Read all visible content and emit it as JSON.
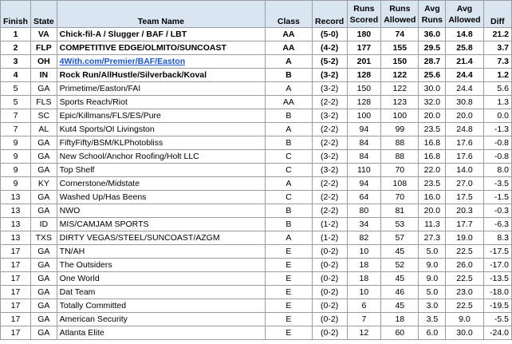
{
  "headers": {
    "finish": "Finish",
    "state": "State",
    "team_name": "Team Name",
    "class": "Class",
    "record": "Record",
    "runs_scored": [
      "Runs",
      "Scored"
    ],
    "runs_allowed": [
      "Runs",
      "Allowed"
    ],
    "avg_runs": [
      "Avg",
      "Runs"
    ],
    "avg_allowed": [
      "Avg",
      "Allowed"
    ],
    "diff": "Diff"
  },
  "rows": [
    {
      "finish": "1",
      "state": "VA",
      "team": "Chick-fil-A / Slugger / BAF / LBT",
      "class": "AA",
      "record": "(5-0)",
      "scored": "180",
      "allowed": "74",
      "avg_runs": "36.0",
      "avg_allowed": "14.8",
      "diff": "21.2",
      "bold": true,
      "link": false
    },
    {
      "finish": "2",
      "state": "FLP",
      "team": "COMPETITIVE EDGE/OLMITO/SUNCOAST",
      "class": "AA",
      "record": "(4-2)",
      "scored": "177",
      "allowed": "155",
      "avg_runs": "29.5",
      "avg_allowed": "25.8",
      "diff": "3.7",
      "bold": true,
      "link": false
    },
    {
      "finish": "3",
      "state": "OH",
      "team": "4With.com/Premier/BAF/Easton",
      "class": "A",
      "record": "(5-2)",
      "scored": "201",
      "allowed": "150",
      "avg_runs": "28.7",
      "avg_allowed": "21.4",
      "diff": "7.3",
      "bold": true,
      "link": true
    },
    {
      "finish": "4",
      "state": "IN",
      "team": "Rock Run/AllHustle/Silverback/Koval",
      "class": "B",
      "record": "(3-2)",
      "scored": "128",
      "allowed": "122",
      "avg_runs": "25.6",
      "avg_allowed": "24.4",
      "diff": "1.2",
      "bold": true,
      "link": false
    },
    {
      "finish": "5",
      "state": "GA",
      "team": "Primetime/Easton/FAI",
      "class": "A",
      "record": "(3-2)",
      "scored": "150",
      "allowed": "122",
      "avg_runs": "30.0",
      "avg_allowed": "24.4",
      "diff": "5.6",
      "bold": false,
      "link": false
    },
    {
      "finish": "5",
      "state": "FLS",
      "team": "Sports Reach/Riot",
      "class": "AA",
      "record": "(2-2)",
      "scored": "128",
      "allowed": "123",
      "avg_runs": "32.0",
      "avg_allowed": "30.8",
      "diff": "1.3",
      "bold": false,
      "link": false
    },
    {
      "finish": "7",
      "state": "SC",
      "team": "Epic/Killmans/FLS/ES/Pure",
      "class": "B",
      "record": "(3-2)",
      "scored": "100",
      "allowed": "100",
      "avg_runs": "20.0",
      "avg_allowed": "20.0",
      "diff": "0.0",
      "bold": false,
      "link": false
    },
    {
      "finish": "7",
      "state": "AL",
      "team": "Kut4 Sports/OI Livingston",
      "class": "A",
      "record": "(2-2)",
      "scored": "94",
      "allowed": "99",
      "avg_runs": "23.5",
      "avg_allowed": "24.8",
      "diff": "-1.3",
      "bold": false,
      "link": false
    },
    {
      "finish": "9",
      "state": "GA",
      "team": "FiftyFifty/BSM/KLPhotobliss",
      "class": "B",
      "record": "(2-2)",
      "scored": "84",
      "allowed": "88",
      "avg_runs": "16.8",
      "avg_allowed": "17.6",
      "diff": "-0.8",
      "bold": false,
      "link": false
    },
    {
      "finish": "9",
      "state": "GA",
      "team": "New School/Anchor Roofing/Holt LLC",
      "class": "C",
      "record": "(3-2)",
      "scored": "84",
      "allowed": "88",
      "avg_runs": "16.8",
      "avg_allowed": "17.6",
      "diff": "-0.8",
      "bold": false,
      "link": false
    },
    {
      "finish": "9",
      "state": "GA",
      "team": "Top Shelf",
      "class": "C",
      "record": "(3-2)",
      "scored": "110",
      "allowed": "70",
      "avg_runs": "22.0",
      "avg_allowed": "14.0",
      "diff": "8.0",
      "bold": false,
      "link": false
    },
    {
      "finish": "9",
      "state": "KY",
      "team": "Cornerstone/Midstate",
      "class": "A",
      "record": "(2-2)",
      "scored": "94",
      "allowed": "108",
      "avg_runs": "23.5",
      "avg_allowed": "27.0",
      "diff": "-3.5",
      "bold": false,
      "link": false
    },
    {
      "finish": "13",
      "state": "GA",
      "team": "Washed Up/Has Beens",
      "class": "C",
      "record": "(2-2)",
      "scored": "64",
      "allowed": "70",
      "avg_runs": "16.0",
      "avg_allowed": "17.5",
      "diff": "-1.5",
      "bold": false,
      "link": false
    },
    {
      "finish": "13",
      "state": "GA",
      "team": "NWO",
      "class": "B",
      "record": "(2-2)",
      "scored": "80",
      "allowed": "81",
      "avg_runs": "20.0",
      "avg_allowed": "20.3",
      "diff": "-0.3",
      "bold": false,
      "link": false
    },
    {
      "finish": "13",
      "state": "ID",
      "team": "MIS/CAMJAM SPORTS",
      "class": "B",
      "record": "(1-2)",
      "scored": "34",
      "allowed": "53",
      "avg_runs": "11.3",
      "avg_allowed": "17.7",
      "diff": "-6.3",
      "bold": false,
      "link": false
    },
    {
      "finish": "13",
      "state": "TXS",
      "team": "DIRTY VEGAS/STEEL/SUNCOAST/AZGM",
      "class": "A",
      "record": "(1-2)",
      "scored": "82",
      "allowed": "57",
      "avg_runs": "27.3",
      "avg_allowed": "19.0",
      "diff": "8.3",
      "bold": false,
      "link": false
    },
    {
      "finish": "17",
      "state": "GA",
      "team": "TN/AH",
      "class": "E",
      "record": "(0-2)",
      "scored": "10",
      "allowed": "45",
      "avg_runs": "5.0",
      "avg_allowed": "22.5",
      "diff": "-17.5",
      "bold": false,
      "link": false
    },
    {
      "finish": "17",
      "state": "GA",
      "team": "The Outsiders",
      "class": "E",
      "record": "(0-2)",
      "scored": "18",
      "allowed": "52",
      "avg_runs": "9.0",
      "avg_allowed": "26.0",
      "diff": "-17.0",
      "bold": false,
      "link": false
    },
    {
      "finish": "17",
      "state": "GA",
      "team": "One World",
      "class": "E",
      "record": "(0-2)",
      "scored": "18",
      "allowed": "45",
      "avg_runs": "9.0",
      "avg_allowed": "22.5",
      "diff": "-13.5",
      "bold": false,
      "link": false
    },
    {
      "finish": "17",
      "state": "GA",
      "team": "Dat Team",
      "class": "E",
      "record": "(0-2)",
      "scored": "10",
      "allowed": "46",
      "avg_runs": "5.0",
      "avg_allowed": "23.0",
      "diff": "-18.0",
      "bold": false,
      "link": false
    },
    {
      "finish": "17",
      "state": "GA",
      "team": "Totally Committed",
      "class": "E",
      "record": "(0-2)",
      "scored": "6",
      "allowed": "45",
      "avg_runs": "3.0",
      "avg_allowed": "22.5",
      "diff": "-19.5",
      "bold": false,
      "link": false
    },
    {
      "finish": "17",
      "state": "GA",
      "team": "American Security",
      "class": "E",
      "record": "(0-2)",
      "scored": "7",
      "allowed": "18",
      "avg_runs": "3.5",
      "avg_allowed": "9.0",
      "diff": "-5.5",
      "bold": false,
      "link": false
    },
    {
      "finish": "17",
      "state": "GA",
      "team": "Atlanta Elite",
      "class": "E",
      "record": "(0-2)",
      "scored": "12",
      "allowed": "60",
      "avg_runs": "6.0",
      "avg_allowed": "30.0",
      "diff": "-24.0",
      "bold": false,
      "link": false
    }
  ]
}
